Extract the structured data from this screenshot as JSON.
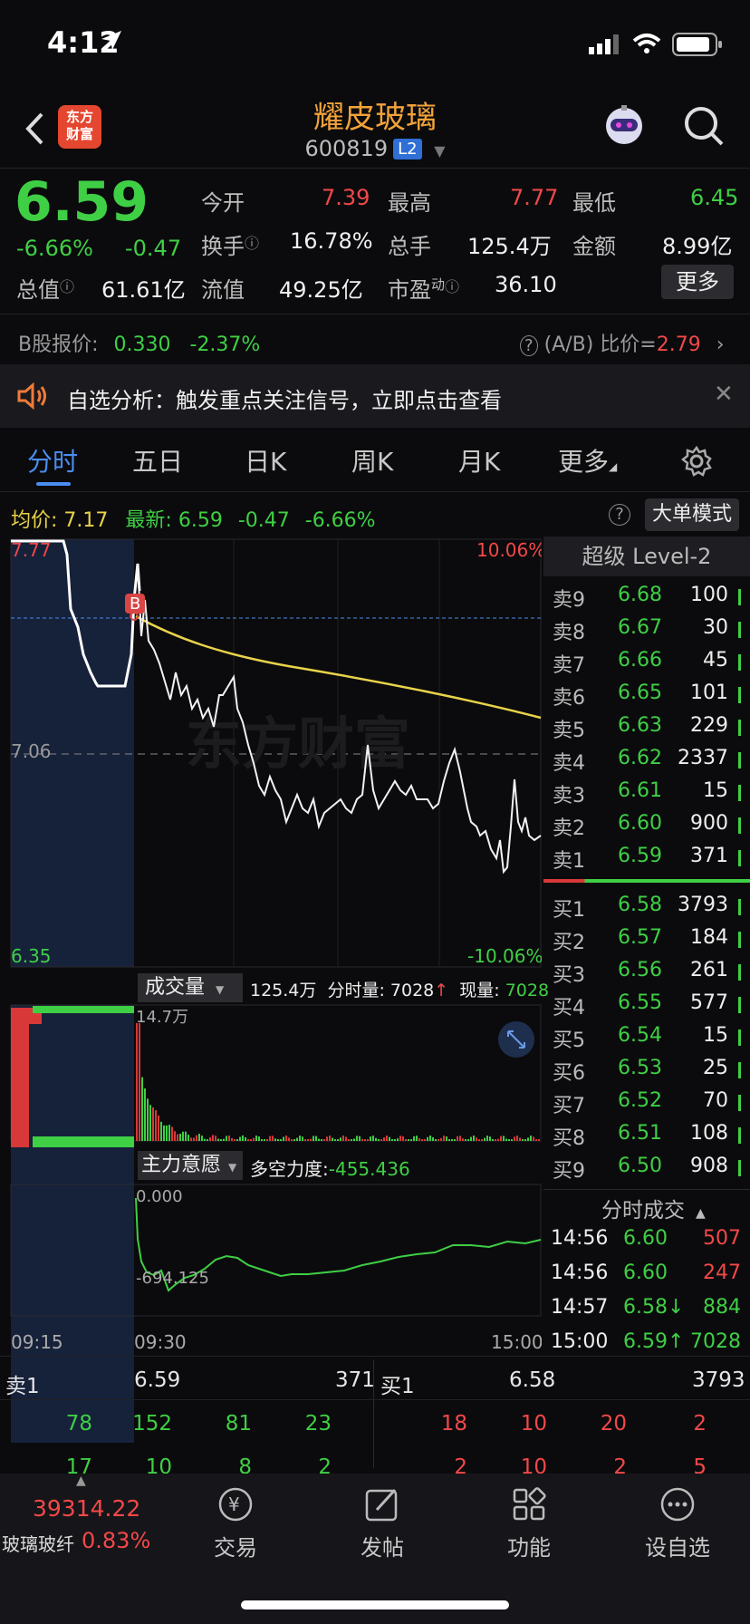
{
  "status_bar": {
    "time": "4:12"
  },
  "header": {
    "title": "耀皮玻璃",
    "code": "600819",
    "level_badge": "L2",
    "logo_text": "东方财富"
  },
  "quote": {
    "price": "6.59",
    "change_pct": "-6.66%",
    "change": "-0.47",
    "open_label": "今开",
    "open": "7.39",
    "high_label": "最高",
    "high": "7.77",
    "low_label": "最低",
    "low": "6.45",
    "turnover_label": "换手",
    "turnover": "16.78%",
    "volume_label": "总手",
    "volume": "125.4万",
    "amount_label": "金额",
    "amount": "8.99亿",
    "mktcap_label": "总值",
    "mktcap": "61.61亿",
    "float_label": "流值",
    "float": "49.25亿",
    "pe_label": "市盈",
    "pe_sup": "动",
    "pe": "36.10",
    "more_button": "更多"
  },
  "b_share": {
    "label": "B股报价:",
    "price": "0.330",
    "pct": "-2.37%",
    "ratio_label": "(A/B) 比价=",
    "ratio": "2.79"
  },
  "notice": {
    "text": "自选分析：触发重点关注信号，立即点击查看"
  },
  "tabs": [
    "分时",
    "五日",
    "日K",
    "周K",
    "月K",
    "更多"
  ],
  "chart_info": {
    "avg_label": "均价:",
    "avg": "7.17",
    "latest_label": "最新:",
    "latest": "6.59",
    "latest_chg": "-0.47",
    "latest_pct": "-6.66%",
    "big_order_button": "大单模式"
  },
  "price_chart": {
    "high_label": "7.77",
    "mid_label": "7.06",
    "low_label": "6.35",
    "top_pct": "10.06%",
    "bottom_pct": "-10.06%",
    "watermark": "东方财富",
    "marker": "B"
  },
  "volume_panel": {
    "selector": "成交量",
    "total": "125.4万",
    "period_label": "分时量:",
    "period_value": "7028",
    "now_label": "现量:",
    "now_value": "7028",
    "max_label": "14.7万"
  },
  "force_panel": {
    "selector": "主力意愿",
    "label": "多空力度:",
    "value": "-455.436",
    "top_label": "0.000",
    "bottom_label": "-694.125",
    "times": [
      "09:15",
      "09:30",
      "15:00"
    ]
  },
  "order_book": {
    "title": "超级 Level-2",
    "sells": [
      {
        "label": "卖9",
        "price": "6.68",
        "vol": "100"
      },
      {
        "label": "卖8",
        "price": "6.67",
        "vol": "30"
      },
      {
        "label": "卖7",
        "price": "6.66",
        "vol": "45"
      },
      {
        "label": "卖6",
        "price": "6.65",
        "vol": "101"
      },
      {
        "label": "卖5",
        "price": "6.63",
        "vol": "229"
      },
      {
        "label": "卖4",
        "price": "6.62",
        "vol": "2337"
      },
      {
        "label": "卖3",
        "price": "6.61",
        "vol": "15"
      },
      {
        "label": "卖2",
        "price": "6.60",
        "vol": "900"
      },
      {
        "label": "卖1",
        "price": "6.59",
        "vol": "371"
      }
    ],
    "buys": [
      {
        "label": "买1",
        "price": "6.58",
        "vol": "3793"
      },
      {
        "label": "买2",
        "price": "6.57",
        "vol": "184"
      },
      {
        "label": "买3",
        "price": "6.56",
        "vol": "261"
      },
      {
        "label": "买4",
        "price": "6.55",
        "vol": "577"
      },
      {
        "label": "买5",
        "price": "6.54",
        "vol": "15"
      },
      {
        "label": "买6",
        "price": "6.53",
        "vol": "25"
      },
      {
        "label": "买7",
        "price": "6.52",
        "vol": "70"
      },
      {
        "label": "买8",
        "price": "6.51",
        "vol": "108"
      },
      {
        "label": "买9",
        "price": "6.50",
        "vol": "908"
      }
    ]
  },
  "trades": {
    "title": "分时成交",
    "rows": [
      {
        "time": "14:56",
        "price": "6.60",
        "vol": "507"
      },
      {
        "time": "14:56",
        "price": "6.60",
        "vol": "247"
      },
      {
        "time": "14:57",
        "price": "6.58↓",
        "vol": "884"
      },
      {
        "time": "15:00",
        "price": "6.59↑",
        "vol": "7028"
      }
    ]
  },
  "queue": {
    "sell_label": "卖1",
    "sell_price": "6.59",
    "sell_vol": "371",
    "buy_label": "买1",
    "buy_price": "6.58",
    "buy_vol": "3793",
    "sell_row1": [
      "78",
      "152",
      "81",
      "23"
    ],
    "buy_row1": [
      "18",
      "10",
      "20",
      "2"
    ],
    "sell_row2": [
      "17",
      "10",
      "8",
      "2"
    ],
    "buy_row2": [
      "2",
      "10",
      "2",
      "5"
    ]
  },
  "bottom_nav": {
    "index_value": "39314.22",
    "index_name": "玻璃玻纤",
    "index_pct": "0.83%",
    "items": [
      "交易",
      "发帖",
      "功能",
      "设自选"
    ]
  }
}
